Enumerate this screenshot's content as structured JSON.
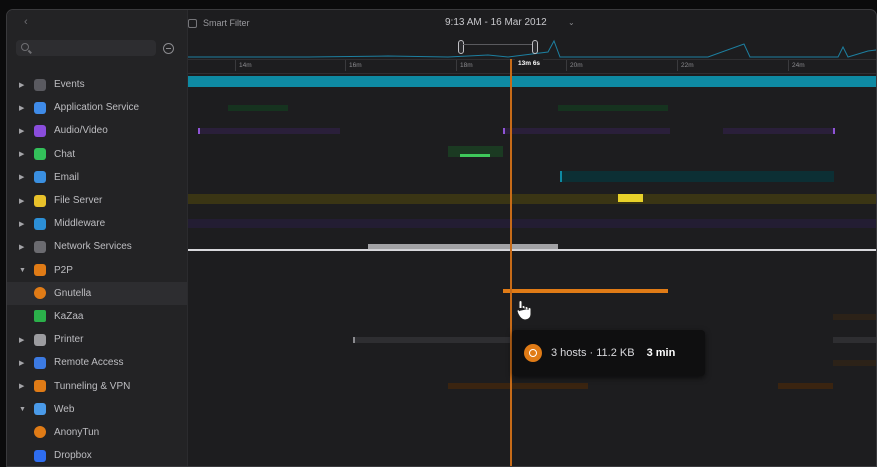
{
  "toolbar": {
    "smart_filter_label": "Smart Filter",
    "date_label": "9:13 AM - 16 Mar 2012",
    "date_chevron": "⌄",
    "back_glyph": "‹"
  },
  "search": {
    "placeholder": ""
  },
  "ruler": {
    "ticks": [
      "14m",
      "16m",
      "18m",
      "20m",
      "22m",
      "24m"
    ],
    "cursor_label": "13m 6s"
  },
  "sidebar": {
    "items": [
      {
        "label": "Events",
        "icon": "events-icon",
        "expanded": false
      },
      {
        "label": "Application Service",
        "icon": "application-service-icon",
        "expanded": false
      },
      {
        "label": "Audio/Video",
        "icon": "audio-video-icon",
        "expanded": false
      },
      {
        "label": "Chat",
        "icon": "chat-icon",
        "expanded": false
      },
      {
        "label": "Email",
        "icon": "email-icon",
        "expanded": false
      },
      {
        "label": "File Server",
        "icon": "file-server-icon",
        "expanded": false
      },
      {
        "label": "Middleware",
        "icon": "middleware-icon",
        "expanded": false
      },
      {
        "label": "Network Services",
        "icon": "network-services-icon",
        "expanded": false
      },
      {
        "label": "P2P",
        "icon": "p2p-icon",
        "expanded": true
      },
      {
        "label": "Gnutella",
        "icon": "gnutella-icon",
        "child": true,
        "selected": true
      },
      {
        "label": "KaZaa",
        "icon": "kazaa-icon",
        "child": true
      },
      {
        "label": "Printer",
        "icon": "printer-icon",
        "expanded": false
      },
      {
        "label": "Remote Access",
        "icon": "remote-access-icon",
        "expanded": false
      },
      {
        "label": "Tunneling & VPN",
        "icon": "tunneling-vpn-icon",
        "expanded": false
      },
      {
        "label": "Web",
        "icon": "web-icon",
        "expanded": true
      },
      {
        "label": "AnonyTun",
        "icon": "anonytun-icon",
        "child": true
      },
      {
        "label": "Dropbox",
        "icon": "dropbox-icon",
        "child": true
      }
    ]
  },
  "tooltip": {
    "summary": "3 hosts · 11.2 KB",
    "duration": "3 min"
  },
  "colors": {
    "events": "#0e8aa3",
    "application_service": "#1e6b3f",
    "audio_video": "#8f54d6",
    "chat": "#3ec95a",
    "email": "#0e6b78",
    "file_server": "#d4c21e",
    "middleware": "#6a3fb8",
    "network_services": "#e6e6e6",
    "p2p": "#e07b16",
    "cursor": "#c76b18"
  }
}
